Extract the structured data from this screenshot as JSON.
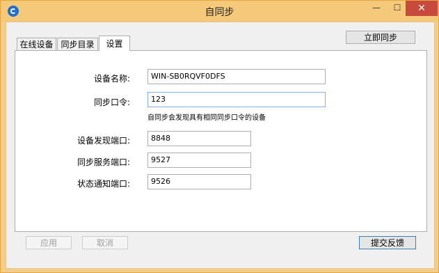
{
  "window": {
    "title": "自同步",
    "minimize_glyph": "—",
    "maximize_glyph": "☐",
    "close_glyph": "✕"
  },
  "tabs": [
    {
      "label": "在线设备",
      "active": false
    },
    {
      "label": "同步目录",
      "active": false
    },
    {
      "label": "设置",
      "active": true
    }
  ],
  "toolbar": {
    "sync_now_label": "立即同步"
  },
  "settings": {
    "device_name_label": "设备名称:",
    "device_name_value": "WIN-SB0RQVF0DFS",
    "sync_password_label": "同步口令:",
    "sync_password_value": "123",
    "sync_password_hint": "自同步会发现具有相同同步口令的设备",
    "discovery_port_label": "设备发现端口:",
    "discovery_port_value": "8848",
    "service_port_label": "同步服务端口:",
    "service_port_value": "9527",
    "notify_port_label": "状态通知端口:",
    "notify_port_value": "9526"
  },
  "footer": {
    "apply_label": "应用",
    "cancel_label": "取消",
    "feedback_label": "提交反馈"
  },
  "colors": {
    "titlebar": "#f5c97a",
    "close_button": "#c74a3c",
    "focus_border": "#7eb4ea",
    "app_icon": "#1d6fd1"
  },
  "icons": {
    "app": "app-logo-icon",
    "minimize": "minimize-icon",
    "maximize": "maximize-icon",
    "close": "close-icon"
  }
}
